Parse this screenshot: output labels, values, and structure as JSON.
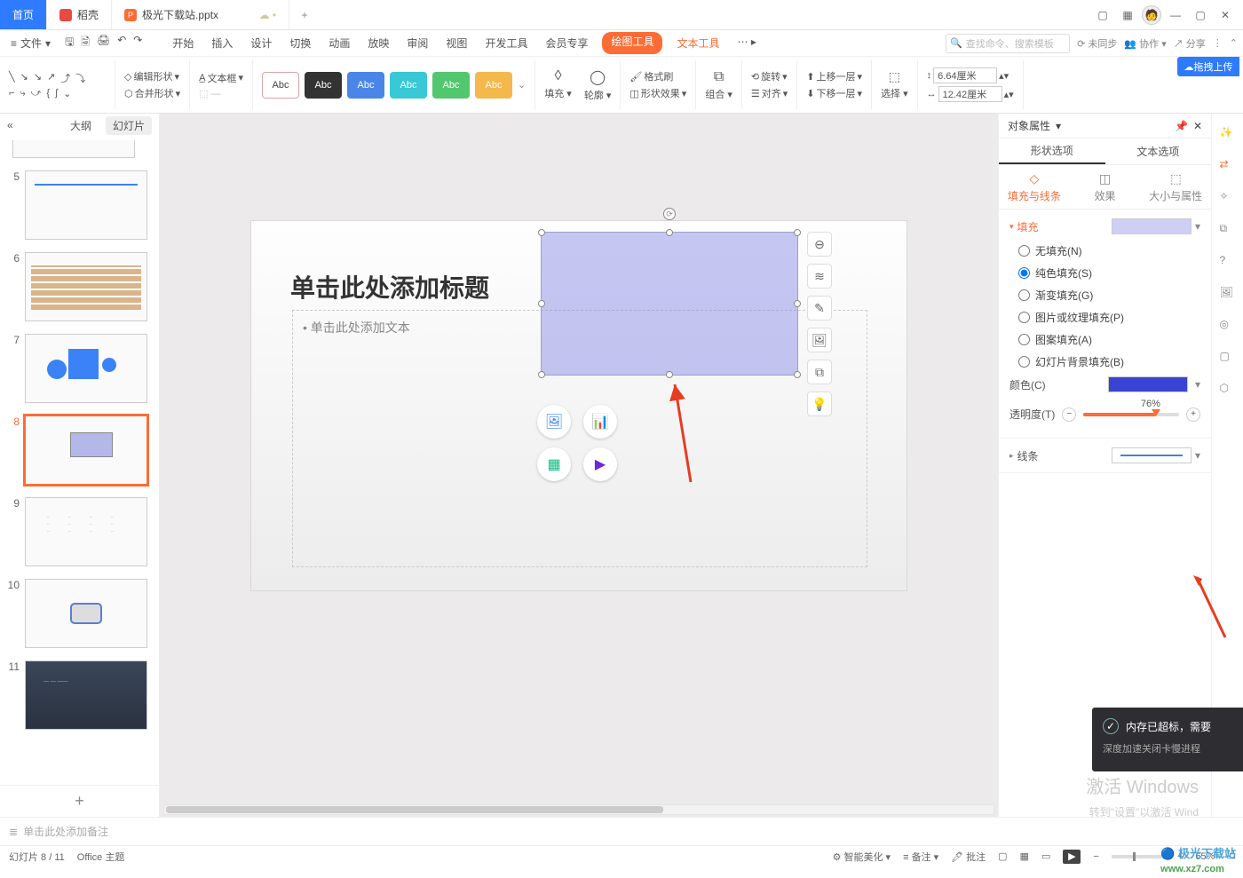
{
  "titlebar": {
    "tabs": {
      "home": "首页",
      "daoke": "稻壳",
      "doc": "极光下载站.pptx"
    },
    "add": "+"
  },
  "menu": {
    "file_label": "文件",
    "tabs": [
      "开始",
      "插入",
      "设计",
      "切换",
      "动画",
      "放映",
      "审阅",
      "视图",
      "开发工具",
      "会员专享"
    ],
    "draw_tool": "绘图工具",
    "text_tool": "文本工具",
    "search_placeholder": "查找命令、搜索模板",
    "sync": "未同步",
    "coop": "协作",
    "share": "分享"
  },
  "ribbon": {
    "edit_shape": "编辑形状",
    "merge_shape": "合并形状",
    "textbox": "文本框",
    "style_label": "Abc",
    "fill": "填充",
    "outline": "轮廓",
    "format_painter": "格式刷",
    "shape_effect": "形状效果",
    "combine": "组合",
    "rotate": "旋转",
    "align": "对齐",
    "bring_forward": "上移一层",
    "send_backward": "下移一层",
    "select": "选择",
    "height_v": "6.64厘米",
    "width_v": "12.42厘米"
  },
  "nav": {
    "collapse": "«",
    "outline_tab": "大纲",
    "slides_tab": "幻灯片",
    "nums": [
      "5",
      "6",
      "7",
      "8",
      "9",
      "10",
      "11"
    ],
    "add": "+"
  },
  "slide": {
    "title": "单击此处添加标题",
    "bullet": "• 单击此处添加文本",
    "notes_placeholder": "单击此处添加备注"
  },
  "prop": {
    "panel_title": "对象属性",
    "shape_opt": "形状选项",
    "text_opt": "文本选项",
    "sub_fill": "填充与线条",
    "sub_effect": "效果",
    "sub_size": "大小与属性",
    "sec_fill": "填充",
    "r_none": "无填充(N)",
    "r_solid": "纯色填充(S)",
    "r_grad": "渐变填充(G)",
    "r_pic": "图片或纹理填充(P)",
    "r_pat": "图案填充(A)",
    "r_bg": "幻灯片背景填充(B)",
    "color_lbl": "颜色(C)",
    "trans_lbl": "透明度(T)",
    "trans_val": "76%",
    "sec_line": "线条"
  },
  "status": {
    "slide_counter": "幻灯片 8 / 11",
    "theme": "Office 主题",
    "beautify": "智能美化",
    "notes": "备注",
    "comments": "批注",
    "zoom": "65%"
  },
  "notif": {
    "line1_a": "内存已超标，需要",
    "line2": "深度加速关闭卡慢进程"
  },
  "watermark": {
    "l1": "激活 Windows",
    "l2": "转到\"设置\"以激活 Wind"
  },
  "brand": {
    "name": "极光下载站",
    "url": "www.xz7.com"
  },
  "cloud_btn": "拖拽上传"
}
